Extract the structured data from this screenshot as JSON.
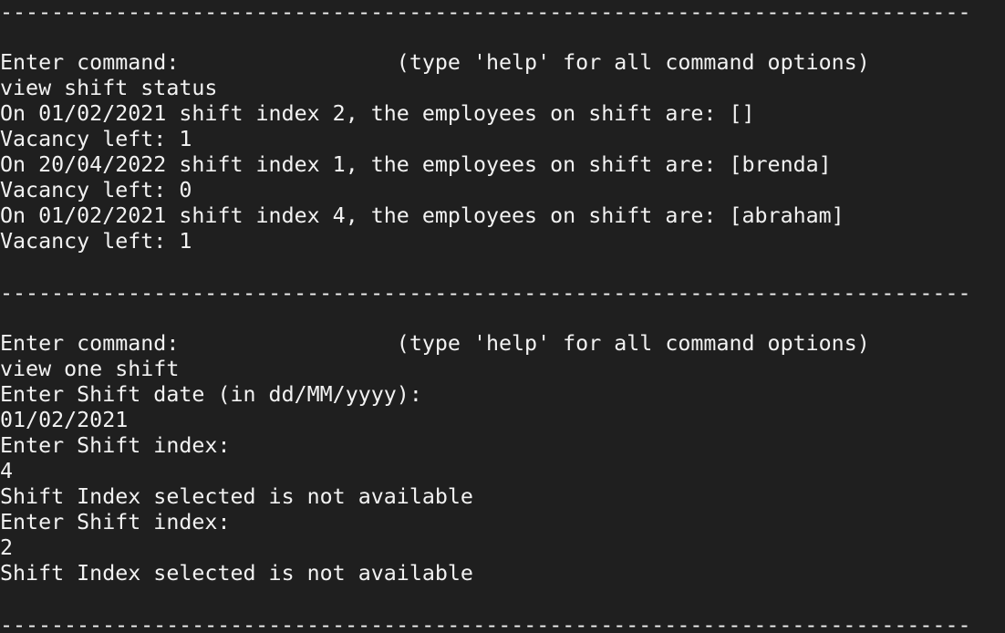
{
  "colors": {
    "background": "#1f1f1f",
    "text": "#f2f2f2"
  },
  "terminal": {
    "separator": "------------------------------------------------------------------------------------------------",
    "lines": {
      "prompt_1": "Enter command:                 (type 'help' for all command options)",
      "cmd_1": "view shift status",
      "out_1": "On 01/02/2021 shift index 2, the employees on shift are: []",
      "out_2": "Vacancy left: 1",
      "out_3": "On 20/04/2022 shift index 1, the employees on shift are: [brenda]",
      "out_4": "Vacancy left: 0",
      "out_5": "On 01/02/2021 shift index 4, the employees on shift are: [abraham]",
      "out_6": "Vacancy left: 1",
      "prompt_2": "Enter command:                 (type 'help' for all command options)",
      "cmd_2": "view one shift",
      "out_7": "Enter Shift date (in dd/MM/yyyy):",
      "in_1": "01/02/2021",
      "out_8": "Enter Shift index:",
      "in_2": "4",
      "out_9": "Shift Index selected is not available",
      "out_10": "Enter Shift index:",
      "in_3": "2",
      "out_11": "Shift Index selected is not available"
    }
  }
}
